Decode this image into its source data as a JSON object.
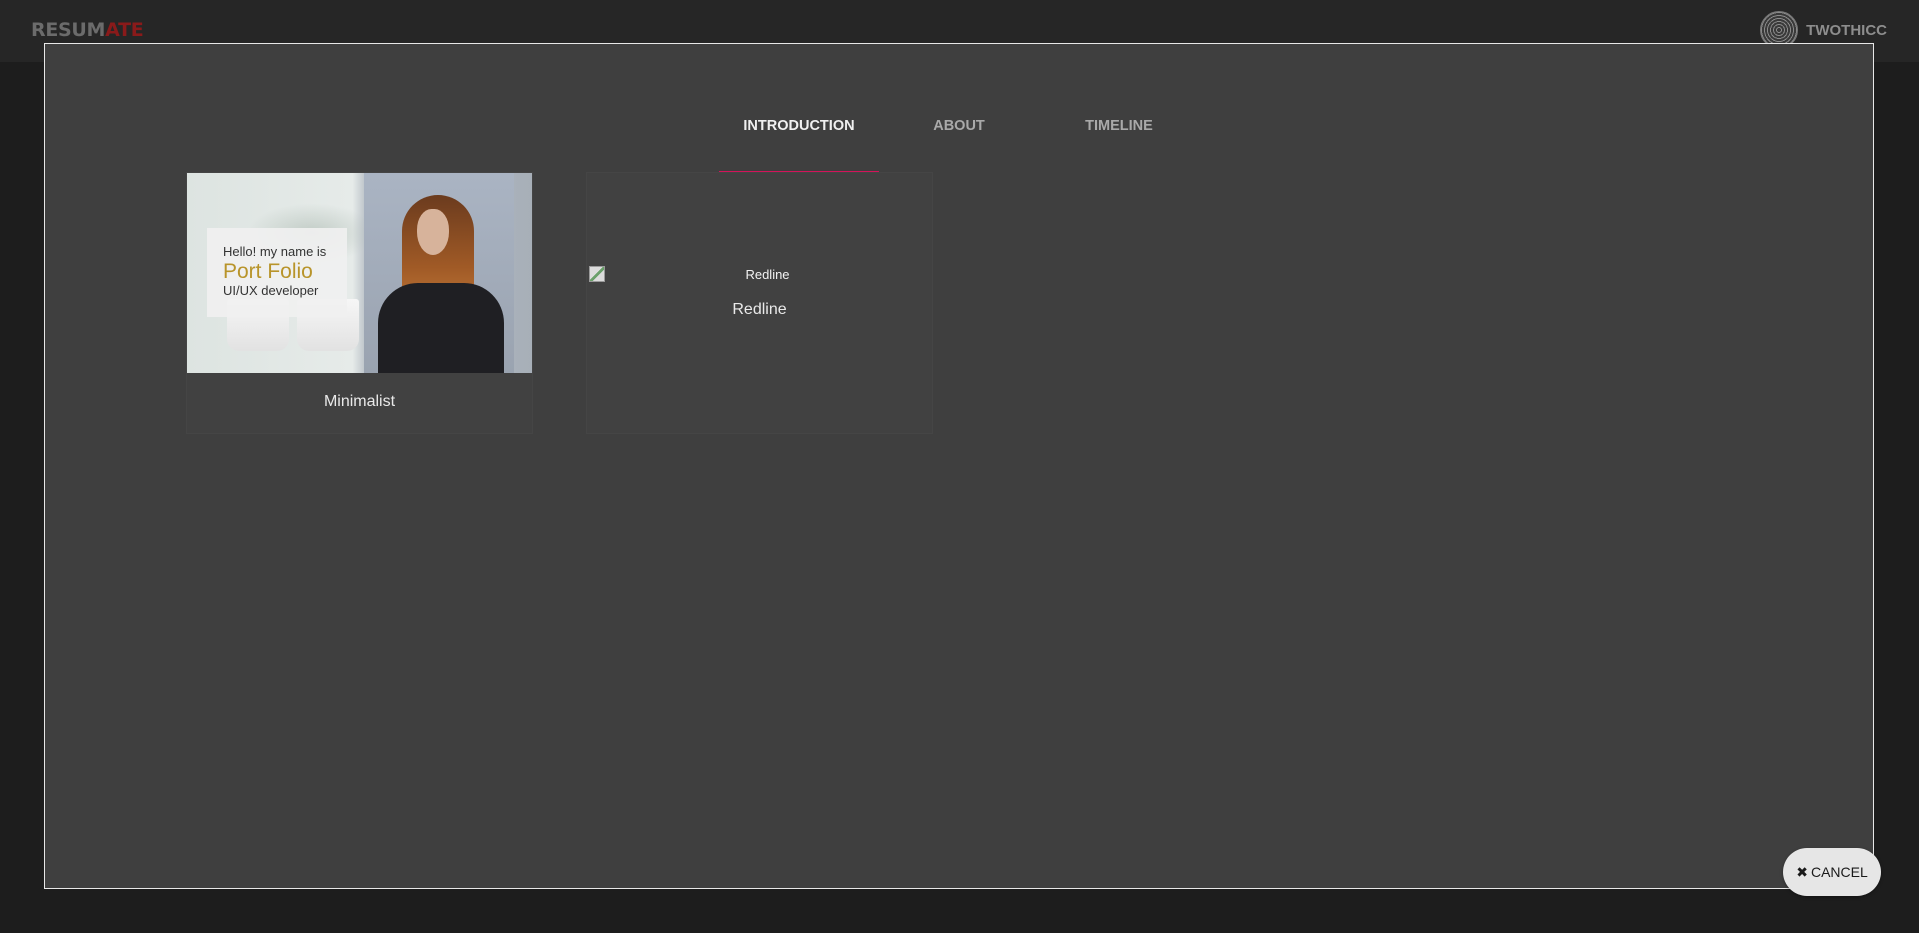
{
  "app": {
    "logo_part1": "RESUM",
    "logo_part2": "ATE",
    "username": "TWOTHICC"
  },
  "background_actions": [
    {
      "icon": "save-icon"
    },
    {
      "icon": "plus-icon"
    },
    {
      "icon": "link-icon"
    },
    {
      "icon": "user-icon"
    }
  ],
  "modal": {
    "tabs": [
      {
        "label": "INTRODUCTION",
        "active": true
      },
      {
        "label": "ABOUT",
        "active": false
      },
      {
        "label": "TIMELINE",
        "active": false
      }
    ],
    "templates": [
      {
        "name": "Minimalist",
        "preview": {
          "line1": "Hello! my name is",
          "line2": "Port Folio",
          "line3": "UI/UX developer"
        }
      },
      {
        "name": "Redline",
        "image_alt": "Redline"
      }
    ],
    "cancel_label": "CANCEL"
  },
  "colors": {
    "accent": "#d4145a",
    "logo_red": "#8a1a1a",
    "modal_bg": "#3f3f3f",
    "topbar_bg": "#262626"
  }
}
